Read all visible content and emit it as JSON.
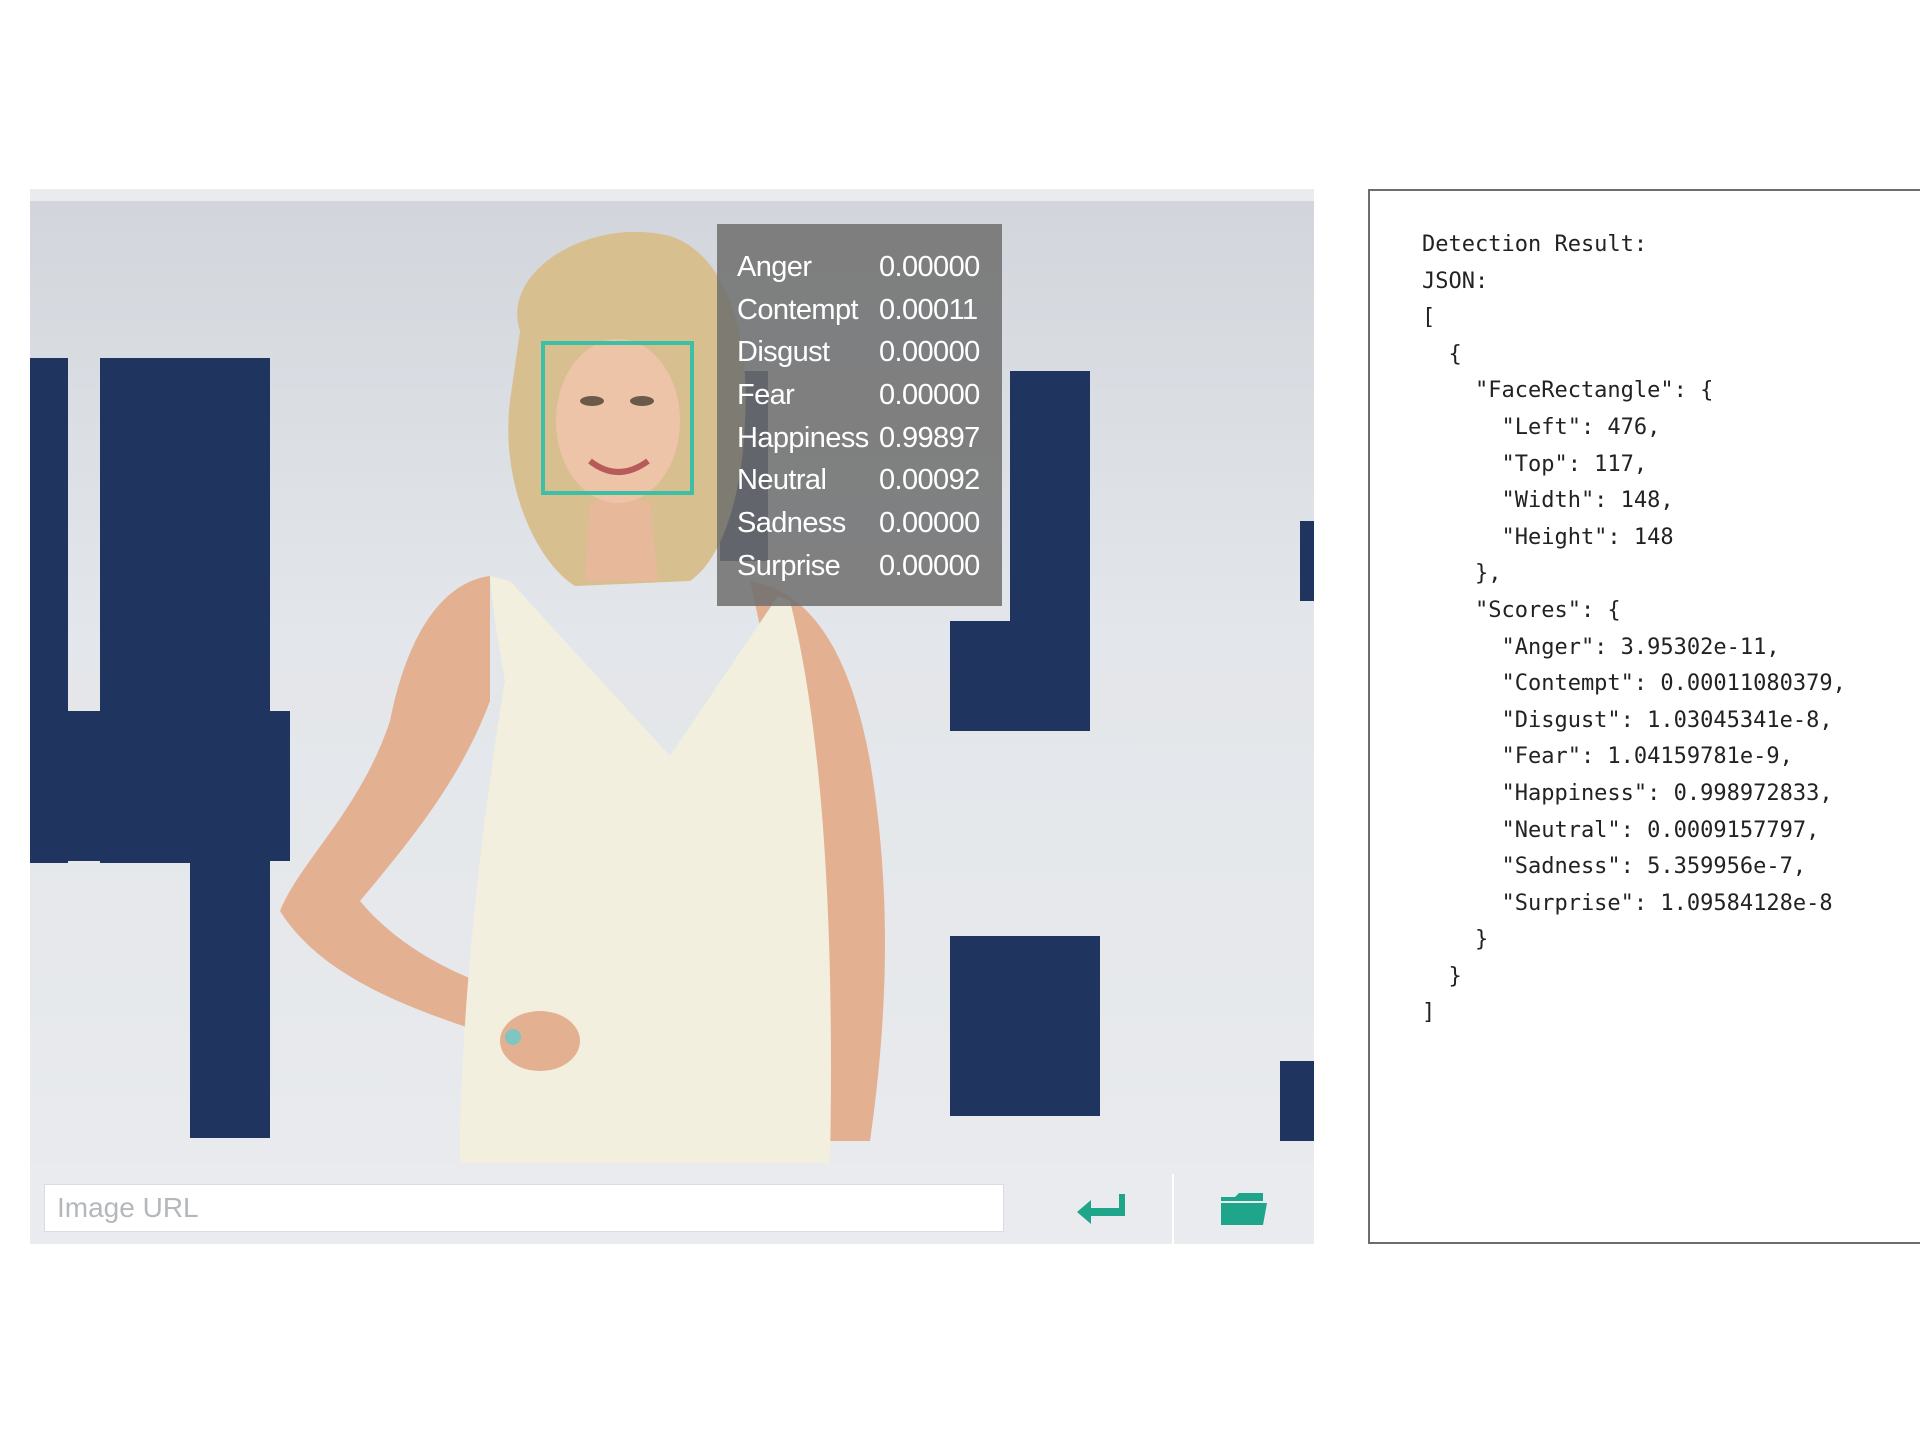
{
  "emotions": [
    {
      "name": "Anger",
      "value": "0.00000"
    },
    {
      "name": "Contempt",
      "value": "0.00011"
    },
    {
      "name": "Disgust",
      "value": "0.00000"
    },
    {
      "name": "Fear",
      "value": "0.00000"
    },
    {
      "name": "Happiness",
      "value": "0.99897"
    },
    {
      "name": "Neutral",
      "value": "0.00092"
    },
    {
      "name": "Sadness",
      "value": "0.00000"
    },
    {
      "name": "Surprise",
      "value": "0.00000"
    }
  ],
  "input": {
    "placeholder": "Image URL",
    "value": ""
  },
  "icons": {
    "enter": "enter-arrow-icon",
    "folder": "open-folder-icon"
  },
  "colors": {
    "accent": "#3dbfa6",
    "overlay": "#6e6e6e",
    "panel_bg": "#e9ebee",
    "backdrop_navy": "#1f3560"
  },
  "result": {
    "lines": [
      "Detection Result:",
      "JSON:",
      "[",
      "  {",
      "    \"FaceRectangle\": {",
      "      \"Left\": 476,",
      "      \"Top\": 117,",
      "      \"Width\": 148,",
      "      \"Height\": 148",
      "    },",
      "    \"Scores\": {",
      "      \"Anger\": 3.95302e-11,",
      "      \"Contempt\": 0.00011080379,",
      "      \"Disgust\": 1.03045341e-8,",
      "      \"Fear\": 1.04159781e-9,",
      "      \"Happiness\": 0.998972833,",
      "      \"Neutral\": 0.0009157797,",
      "      \"Sadness\": 5.359956e-7,",
      "      \"Surprise\": 1.09584128e-8",
      "    }",
      "  }",
      "]"
    ]
  }
}
